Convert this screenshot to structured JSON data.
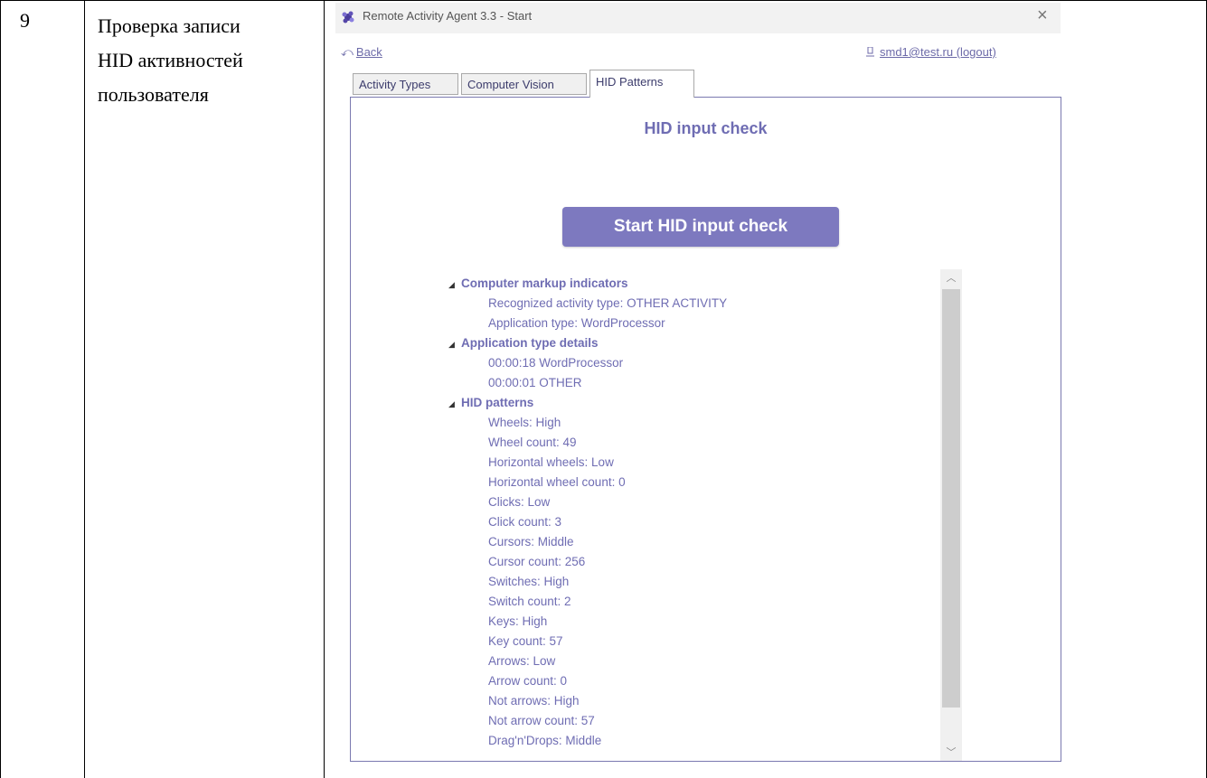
{
  "document": {
    "row_number": "9",
    "description_lines": [
      "Проверка записи",
      "HID активностей",
      "пользователя"
    ]
  },
  "window": {
    "title": "Remote Activity Agent 3.3 - Start",
    "close_symbol": "×"
  },
  "nav": {
    "back_arrow": "⤺",
    "back_label": "Back",
    "user_label": "smd1@test.ru (logout)"
  },
  "tabs": [
    {
      "label": "Activity Types",
      "active": false
    },
    {
      "label": "Computer Vision",
      "active": false
    },
    {
      "label": "HID Patterns",
      "active": true
    }
  ],
  "panel": {
    "heading": "HID input check",
    "start_button": "Start HID input check"
  },
  "tree": {
    "collapse_glyph": "◢",
    "groups": [
      {
        "label": "Computer markup indicators",
        "items": [
          "Recognized activity type: OTHER ACTIVITY",
          "Application type: WordProcessor"
        ]
      },
      {
        "label": "Application type details",
        "items": [
          "00:00:18 WordProcessor",
          "00:00:01 OTHER"
        ]
      },
      {
        "label": "HID patterns",
        "items": [
          "Wheels: High",
          "Wheel count: 49",
          "Horizontal wheels: Low",
          "Horizontal wheel count: 0",
          "Clicks: Low",
          "Click count: 3",
          "Cursors: Middle",
          "Cursor count: 256",
          "Switches: High",
          "Switch count: 2",
          "Keys: High",
          "Key count: 57",
          "Arrows: Low",
          "Arrow count: 0",
          "Not arrows: High",
          "Not arrow count: 57",
          "Drag'n'Drops: Middle"
        ]
      }
    ]
  },
  "scrollbar": {
    "up_glyph": "︿",
    "down_glyph": "﹀"
  },
  "colors": {
    "accent": "#7d79bf",
    "text_accent": "#6f6db3",
    "link": "#6c6aa8",
    "panel_border": "#7a79b0"
  }
}
